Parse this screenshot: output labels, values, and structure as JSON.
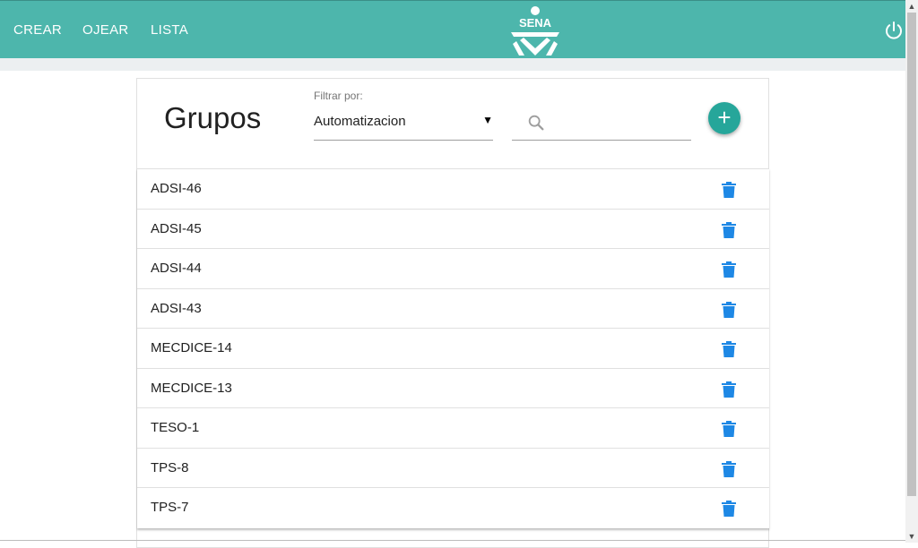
{
  "nav": {
    "items": [
      {
        "label": "CREAR"
      },
      {
        "label": "OJEAR"
      },
      {
        "label": "LISTA"
      }
    ],
    "logo_text": "SENA"
  },
  "page": {
    "title": "Grupos"
  },
  "filter": {
    "label": "Filtrar por:",
    "selected": "Automatizacion"
  },
  "search": {
    "value": ""
  },
  "add_button": {
    "icon": "+"
  },
  "groups": [
    {
      "name": "ADSI-46"
    },
    {
      "name": "ADSI-45"
    },
    {
      "name": "ADSI-44"
    },
    {
      "name": "ADSI-43"
    },
    {
      "name": "MECDICE-14"
    },
    {
      "name": "MECDICE-13"
    },
    {
      "name": "TESO-1"
    },
    {
      "name": "TPS-8"
    },
    {
      "name": "TPS-7"
    }
  ],
  "colors": {
    "primary": "#4db6ac",
    "accent": "#26a69a",
    "trash": "#1e88e5"
  },
  "icons": {
    "power": "power-icon",
    "search": "search-icon",
    "trash": "trash-icon",
    "add": "plus-icon"
  }
}
